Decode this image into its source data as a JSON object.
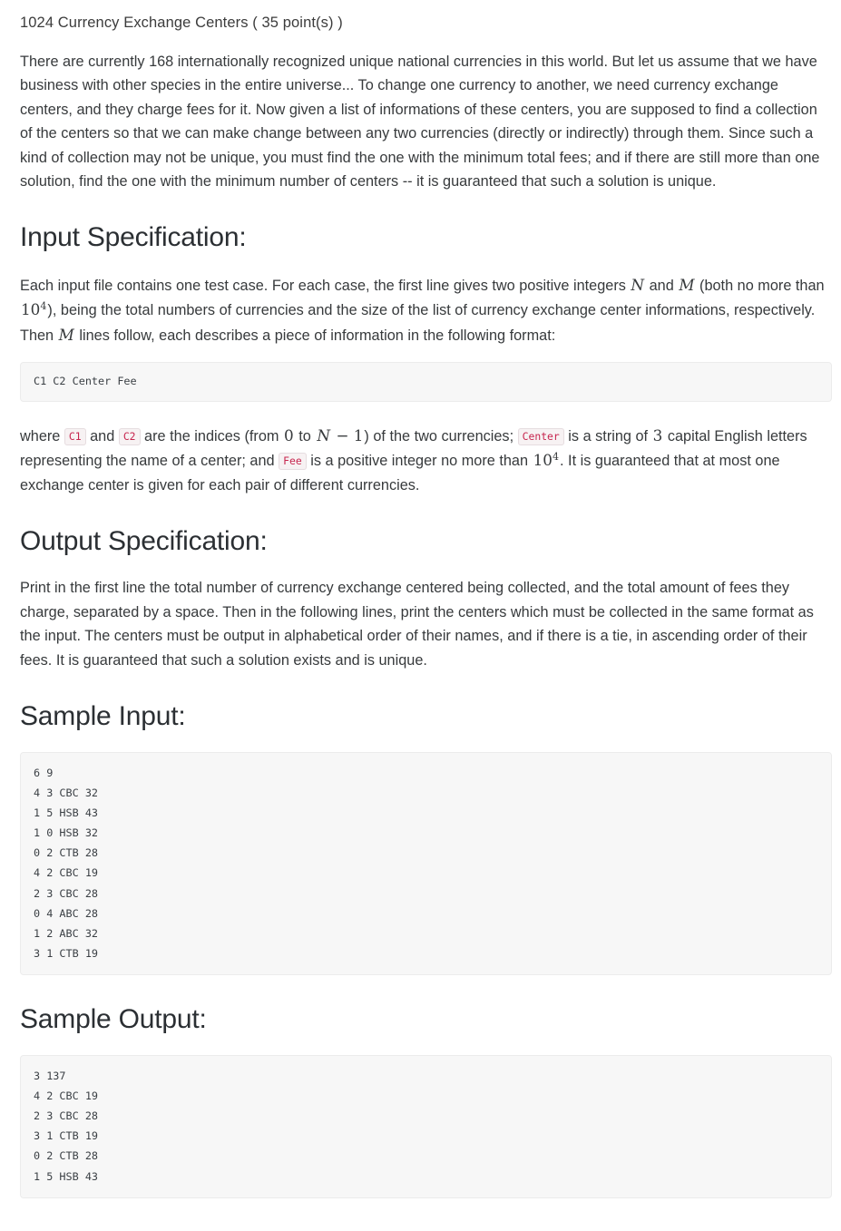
{
  "problem": {
    "title": "1024 Currency Exchange Centers  ( 35 point(s) )",
    "description": "There are currently 168 internationally recognized unique national currencies in this world. But let us assume that we have business with other species in the entire universe... To change one currency to another, we need currency exchange centers, and they charge fees for it. Now given a list of informations of these centers, you are supposed to find a collection of the centers so that we can make change between any two currencies (directly or indirectly) through them. Since such a kind of collection may not be unique, you must find the one with the minimum total fees; and if there are still more than one solution, find the one with the minimum number of centers -- it is guaranteed that such a solution is unique."
  },
  "input_spec": {
    "heading": "Input Specification:",
    "para1_part1": "Each input file contains one test case. For each case, the first line gives two positive integers ",
    "math_N": "N",
    "para1_part2": " and ",
    "math_M": "M",
    "para1_part3": " (both no more than ",
    "math_10_4_base": "10",
    "math_10_4_exp": "4",
    "para1_part4": "), being the total numbers of currencies and the size of the list of currency exchange center informations, respectively. Then ",
    "math_M2": "M",
    "para1_part5": " lines follow, each describes a piece of information in the following format:",
    "format_block": "C1 C2 Center Fee",
    "para2_part1": "where ",
    "code_c1": "C1",
    "para2_part2": " and ",
    "code_c2": "C2",
    "para2_part3": " are the indices (from ",
    "math_0": "0",
    "para2_part4": " to ",
    "math_N_minus_1": "N − 1",
    "para2_part5": ") of the two currencies; ",
    "code_center": "Center",
    "para2_part6": " is a string of ",
    "math_3": "3",
    "para2_part7": " capital English letters representing the name of a center; and ",
    "code_fee": "Fee",
    "para2_part8": " is a positive integer no more than ",
    "math_10_4b_base": "10",
    "math_10_4b_exp": "4",
    "para2_part9": ". It is guaranteed that at most one exchange center is given for each pair of different currencies."
  },
  "output_spec": {
    "heading": "Output Specification:",
    "description": "Print in the first line the total number of currency exchange centered being collected, and the total amount of fees they charge, separated by a space. Then in the following lines, print the centers which must be collected in the same format as the input. The centers must be output in alphabetical order of their names, and if there is a tie, in ascending order of their fees. It is guaranteed that such a solution exists and is unique."
  },
  "sample_input": {
    "heading": "Sample Input:",
    "content": "6 9\n4 3 CBC 32\n1 5 HSB 43\n1 0 HSB 32\n0 2 CTB 28\n4 2 CBC 19\n2 3 CBC 28\n0 4 ABC 28\n1 2 ABC 32\n3 1 CTB 19"
  },
  "sample_output": {
    "heading": "Sample Output:",
    "content": "3 137\n4 2 CBC 19\n2 3 CBC 28\n3 1 CTB 19\n0 2 CTB 28\n1 5 HSB 43"
  },
  "colors": {
    "inline_code_text": "#c7254e",
    "inline_code_bg": "#f7f2f3",
    "code_block_bg": "#f7f7f7",
    "body_text": "#373a3c",
    "heading_text": "#2b2f33"
  }
}
